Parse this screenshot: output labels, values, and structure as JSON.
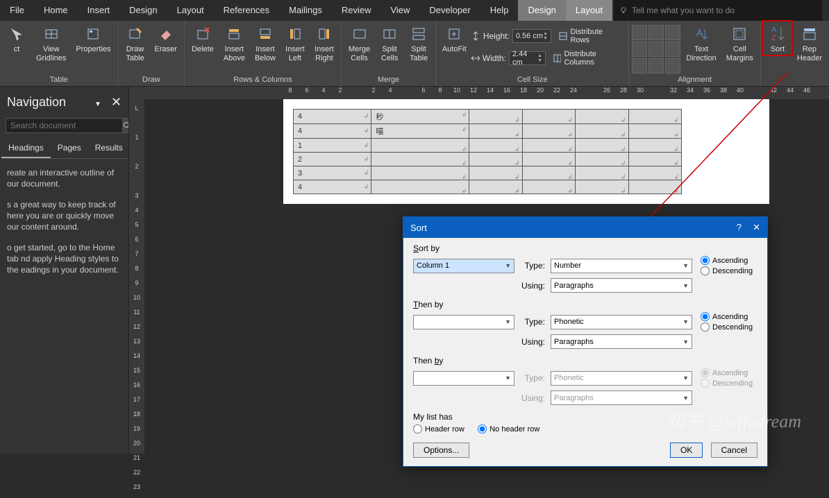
{
  "tabs": {
    "file": "File",
    "home": "Home",
    "insert": "Insert",
    "design": "Design",
    "layout": "Layout",
    "references": "References",
    "mailings": "Mailings",
    "review": "Review",
    "view": "View",
    "developer": "Developer",
    "help": "Help",
    "ctx_design": "Design",
    "ctx_layout": "Layout",
    "tellme_placeholder": "Tell me what you want to do"
  },
  "ribbon": {
    "table": {
      "group": "Table",
      "select": "ct",
      "gridlines": "View\nGridlines",
      "properties": "Properties"
    },
    "draw": {
      "group": "Draw",
      "draw_table": "Draw\nTable",
      "eraser": "Eraser"
    },
    "rowscols": {
      "group": "Rows & Columns",
      "delete": "Delete",
      "above": "Insert\nAbove",
      "below": "Insert\nBelow",
      "left": "Insert\nLeft",
      "right": "Insert\nRight"
    },
    "merge": {
      "group": "Merge",
      "merge_cells": "Merge\nCells",
      "split_cells": "Split\nCells",
      "split_table": "Split\nTable"
    },
    "cellsize": {
      "group": "Cell Size",
      "autofit": "AutoFit",
      "height_label": "Height:",
      "width_label": "Width:",
      "height_val": "0.56 cm",
      "width_val": "2.44 cm",
      "dist_rows": "Distribute Rows",
      "dist_cols": "Distribute Columns"
    },
    "alignment": {
      "group": "Alignment",
      "text_dir": "Text\nDirection",
      "cell_margins": "Cell\nMargins"
    },
    "data": {
      "sort": "Sort",
      "repeat": "Rep\nHeader"
    }
  },
  "nav": {
    "title": "Navigation",
    "search_placeholder": "Search document",
    "tabs": {
      "headings": "Headings",
      "pages": "Pages",
      "results": "Results"
    },
    "p1": "reate an interactive outline of our document.",
    "p2": "s a great way to keep track of here you are or quickly move our content around.",
    "p3": "o get started, go to the Home tab nd apply Heading styles to the eadings in your document."
  },
  "ruler_h": [
    "8",
    "6",
    "4",
    "2",
    "",
    "2",
    "4",
    "",
    "6",
    "8",
    "10",
    "12",
    "14",
    "16",
    "18",
    "20",
    "22",
    "24",
    "",
    "26",
    "28",
    "30",
    "",
    "32",
    "34",
    "36",
    "38",
    "40",
    "",
    "42",
    "44",
    "46"
  ],
  "ruler_v": [
    "L",
    "",
    "1",
    "",
    "2",
    "",
    "3",
    "4",
    "5",
    "6",
    "7",
    "8",
    "9",
    "10",
    "11",
    "12",
    "13",
    "14",
    "15",
    "16",
    "17",
    "18",
    "19",
    "20",
    "21",
    "22",
    "23"
  ],
  "table_rows": [
    [
      "4",
      "秒",
      "",
      "",
      "",
      ""
    ],
    [
      "4",
      "喵",
      "",
      "",
      "",
      ""
    ],
    [
      "1",
      "",
      "",
      "",
      "",
      ""
    ],
    [
      "2",
      "",
      "",
      "",
      "",
      ""
    ],
    [
      "3",
      "",
      "",
      "",
      "",
      ""
    ],
    [
      "4",
      "",
      "",
      "",
      "",
      ""
    ]
  ],
  "dialog": {
    "title": "Sort",
    "sort_by": "Sort by",
    "then_by": "Then by",
    "type": "Type:",
    "using": "Using:",
    "asc": "Ascending",
    "desc": "Descending",
    "col1": "Column 1",
    "number": "Number",
    "paragraphs": "Paragraphs",
    "phonetic": "Phonetic",
    "my_list_has": "My list has",
    "header_row": "Header row",
    "no_header_row": "No header row",
    "options": "Options...",
    "ok": "OK",
    "cancel": "Cancel"
  },
  "watermark": "知乎 @jaffedream"
}
